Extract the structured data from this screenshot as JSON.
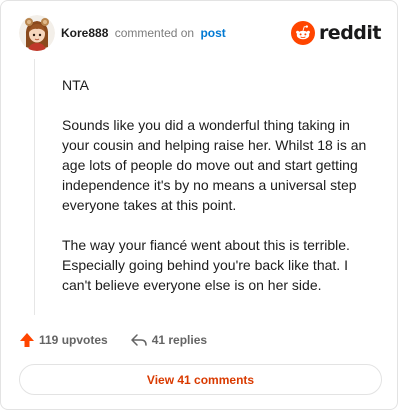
{
  "header": {
    "username": "Kore888",
    "action": "commented on",
    "post_link": "post",
    "brand": "reddit"
  },
  "comment": {
    "paragraphs": [
      "NTA",
      "Sounds like you did a wonderful thing taking in your cousin and helping raise her. Whilst 18 is an age lots of people do move out and start getting independence it's by no means a universal step everyone takes at this point.",
      "The way your fiancé went about this is terrible. Especially going behind you're back like that. I can't believe everyone else is on her side."
    ]
  },
  "footer": {
    "upvotes": "119 upvotes",
    "replies": "41 replies",
    "view_comments": "View 41 comments"
  },
  "colors": {
    "accent": "#ff4500",
    "link": "#0079d3",
    "view_button_text": "#d93a00"
  }
}
